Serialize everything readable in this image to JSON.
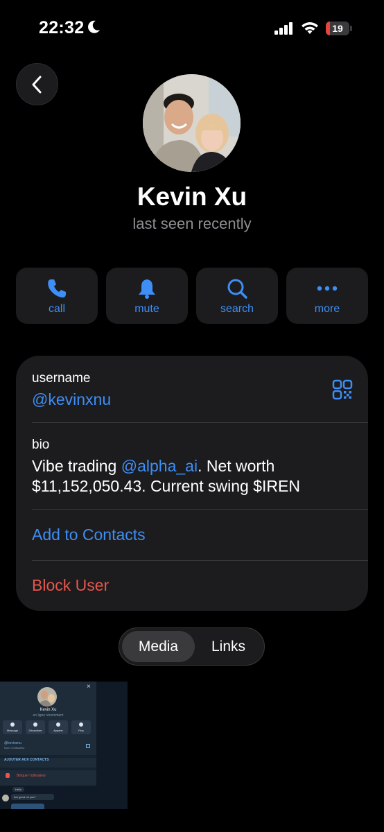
{
  "status_bar": {
    "time": "22:32",
    "battery_level": "19",
    "battery_fraction": 0.19,
    "icons": [
      "moon-icon",
      "signal-icon",
      "wifi-icon",
      "battery-icon"
    ]
  },
  "header": {
    "back_icon": "chevron-left-icon",
    "name": "Kevin Xu",
    "status": "last seen recently"
  },
  "actions": [
    {
      "label": "call",
      "icon": "phone-icon"
    },
    {
      "label": "mute",
      "icon": "bell-icon"
    },
    {
      "label": "search",
      "icon": "search-icon"
    },
    {
      "label": "more",
      "icon": "more-dots-icon"
    }
  ],
  "info": {
    "username_label": "username",
    "username": "@kevinxnu",
    "bio_label": "bio",
    "bio_prefix": "Vibe trading ",
    "bio_mention": "@alpha_ai",
    "bio_suffix": ". Net worth $11,152,050.43. Current swing $IREN",
    "add_contacts": "Add to Contacts",
    "block_user": "Block User"
  },
  "tabs": {
    "items": [
      "Media",
      "Links"
    ],
    "active": "Media"
  },
  "media_thumbnail": {
    "close": "×",
    "name": "Kevin Xu",
    "status": "en ligne récemment",
    "buttons": [
      "Message",
      "Désactiver",
      "Appeler",
      "Plus"
    ],
    "username": "@kevinxnu",
    "username_label": "Nom d'utilisateur",
    "add_contacts": "AJOUTER AUX CONTACTS",
    "block_user": "Bloquer l'utilisateur",
    "message_1": "Hello",
    "message_2": "Am good rot you?"
  },
  "colors": {
    "accent": "#3e8ef5",
    "destructive": "#e5564b",
    "card": "#1c1c1e",
    "secondary_text": "#8e8e93"
  }
}
